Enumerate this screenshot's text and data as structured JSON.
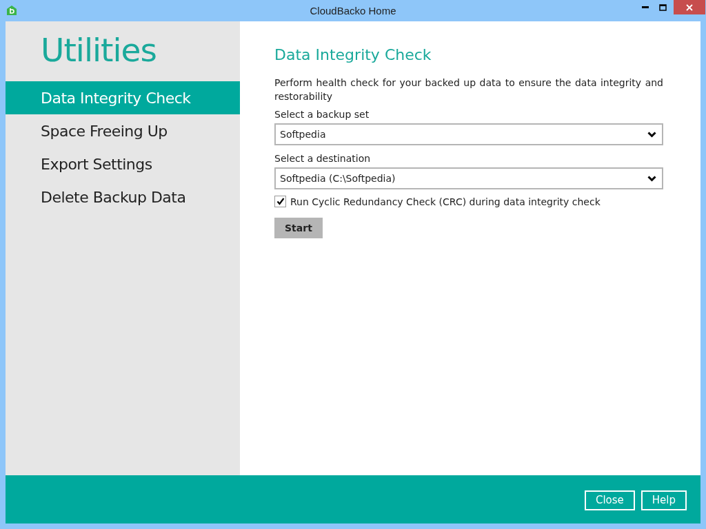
{
  "window": {
    "title": "CloudBacko Home"
  },
  "sidebar": {
    "title": "Utilities",
    "items": [
      {
        "label": "Data Integrity Check",
        "selected": true
      },
      {
        "label": "Space Freeing Up",
        "selected": false
      },
      {
        "label": "Export Settings",
        "selected": false
      },
      {
        "label": "Delete Backup Data",
        "selected": false
      }
    ]
  },
  "content": {
    "heading": "Data Integrity Check",
    "description": "Perform health check for your backed up data to ensure the data integrity and restorability",
    "fields": [
      {
        "label": "Select a backup set",
        "value": "Softpedia"
      },
      {
        "label": "Select a destination",
        "value": "Softpedia (C:\\Softpedia)"
      }
    ],
    "checkbox": {
      "label": "Run Cyclic Redundancy Check (CRC) during data integrity check",
      "checked": true
    },
    "start_button": "Start"
  },
  "footer": {
    "buttons": [
      "Close",
      "Help"
    ]
  }
}
